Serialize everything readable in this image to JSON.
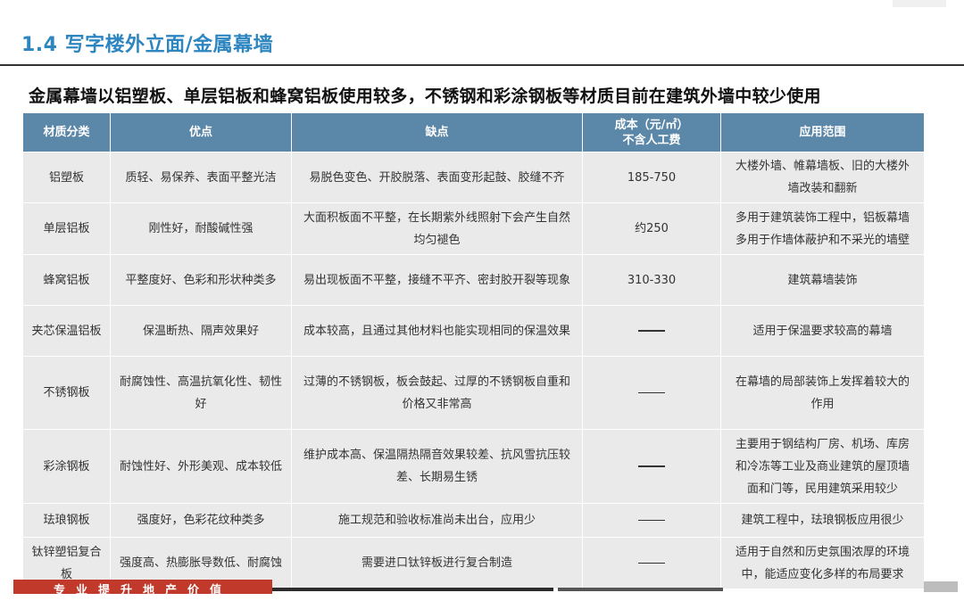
{
  "header": {
    "title": "1.4 写字楼外立面/金属幕墙",
    "subtitle": "金属幕墙以铝塑板、单层铝板和蜂窝铝板使用较多，不锈钢和彩涂钢板等材质目前在建筑外墙中较少使用"
  },
  "table": {
    "headers": [
      "材质分类",
      "优点",
      "缺点",
      "成本（元/㎡）\n不含人工费",
      "应用范围"
    ],
    "rows": [
      {
        "material": "铝塑板",
        "pros": "质轻、易保养、表面平整光洁",
        "cons": "易脱色变色、开胶脱落、表面变形起鼓、胶缝不齐",
        "cost": "185-750",
        "scope": "大楼外墙、帷幕墙板、旧的大楼外墙改装和翻新"
      },
      {
        "material": "单层铝板",
        "pros": "刚性好，耐酸碱性强",
        "cons": "大面积板面不平整，在长期紫外线照射下会产生自然均匀褪色",
        "cost": "约250",
        "scope": "多用于建筑装饰工程中，铝板幕墙多用于作墙体蔽护和不采光的墙壁"
      },
      {
        "material": "蜂窝铝板",
        "pros": "平整度好、色彩和形状种类多",
        "cons": "易出现板面不平整，接缝不平齐、密封胶开裂等现象",
        "cost": "310-330",
        "scope": "建筑幕墙装饰"
      },
      {
        "material": "夹芯保温铝板",
        "pros": "保温断热、隔声效果好",
        "cons": "成本较高，且通过其他材料也能实现相同的保温效果",
        "cost": "——",
        "scope": "适用于保温要求较高的幕墙"
      },
      {
        "material": "不锈钢板",
        "pros": "耐腐蚀性、高温抗氧化性、韧性好",
        "cons": "过薄的不锈钢板，板会鼓起、过厚的不锈钢板自重和价格又非常高",
        "cost": "——",
        "scope": "在幕墙的局部装饰上发挥着较大的作用"
      },
      {
        "material": "彩涂钢板",
        "pros": "耐蚀性好、外形美观、成本较低",
        "cons": "维护成本高、保温隔热隔音效果较差、抗风雪抗压较差、长期易生锈",
        "cost": "——",
        "scope": "主要用于钢结构厂房、机场、库房和冷冻等工业及商业建筑的屋顶墙面和门等，民用建筑采用较少"
      },
      {
        "material": "珐琅钢板",
        "pros": "强度好，色彩花纹种类多",
        "cons": "施工规范和验收标准尚未出台，应用少",
        "cost": "——",
        "scope": "建筑工程中，珐琅钢板应用很少"
      },
      {
        "material": "钛锌塑铝复合板",
        "pros": "强度高、热膨胀导数低、耐腐蚀",
        "cons": "需要进口钛锌板进行复合制造",
        "cost": "——",
        "scope": "适用于自然和历史氛围浓厚的环境中，能适应变化多样的布局要求"
      }
    ]
  },
  "footer": {
    "slogan": "专业提升地产价值"
  },
  "colors": {
    "title": "#2E86C1",
    "header_bg": "#5B87A8",
    "cell_bg": "#EAEAEA",
    "footer_red": "#C0392B"
  }
}
